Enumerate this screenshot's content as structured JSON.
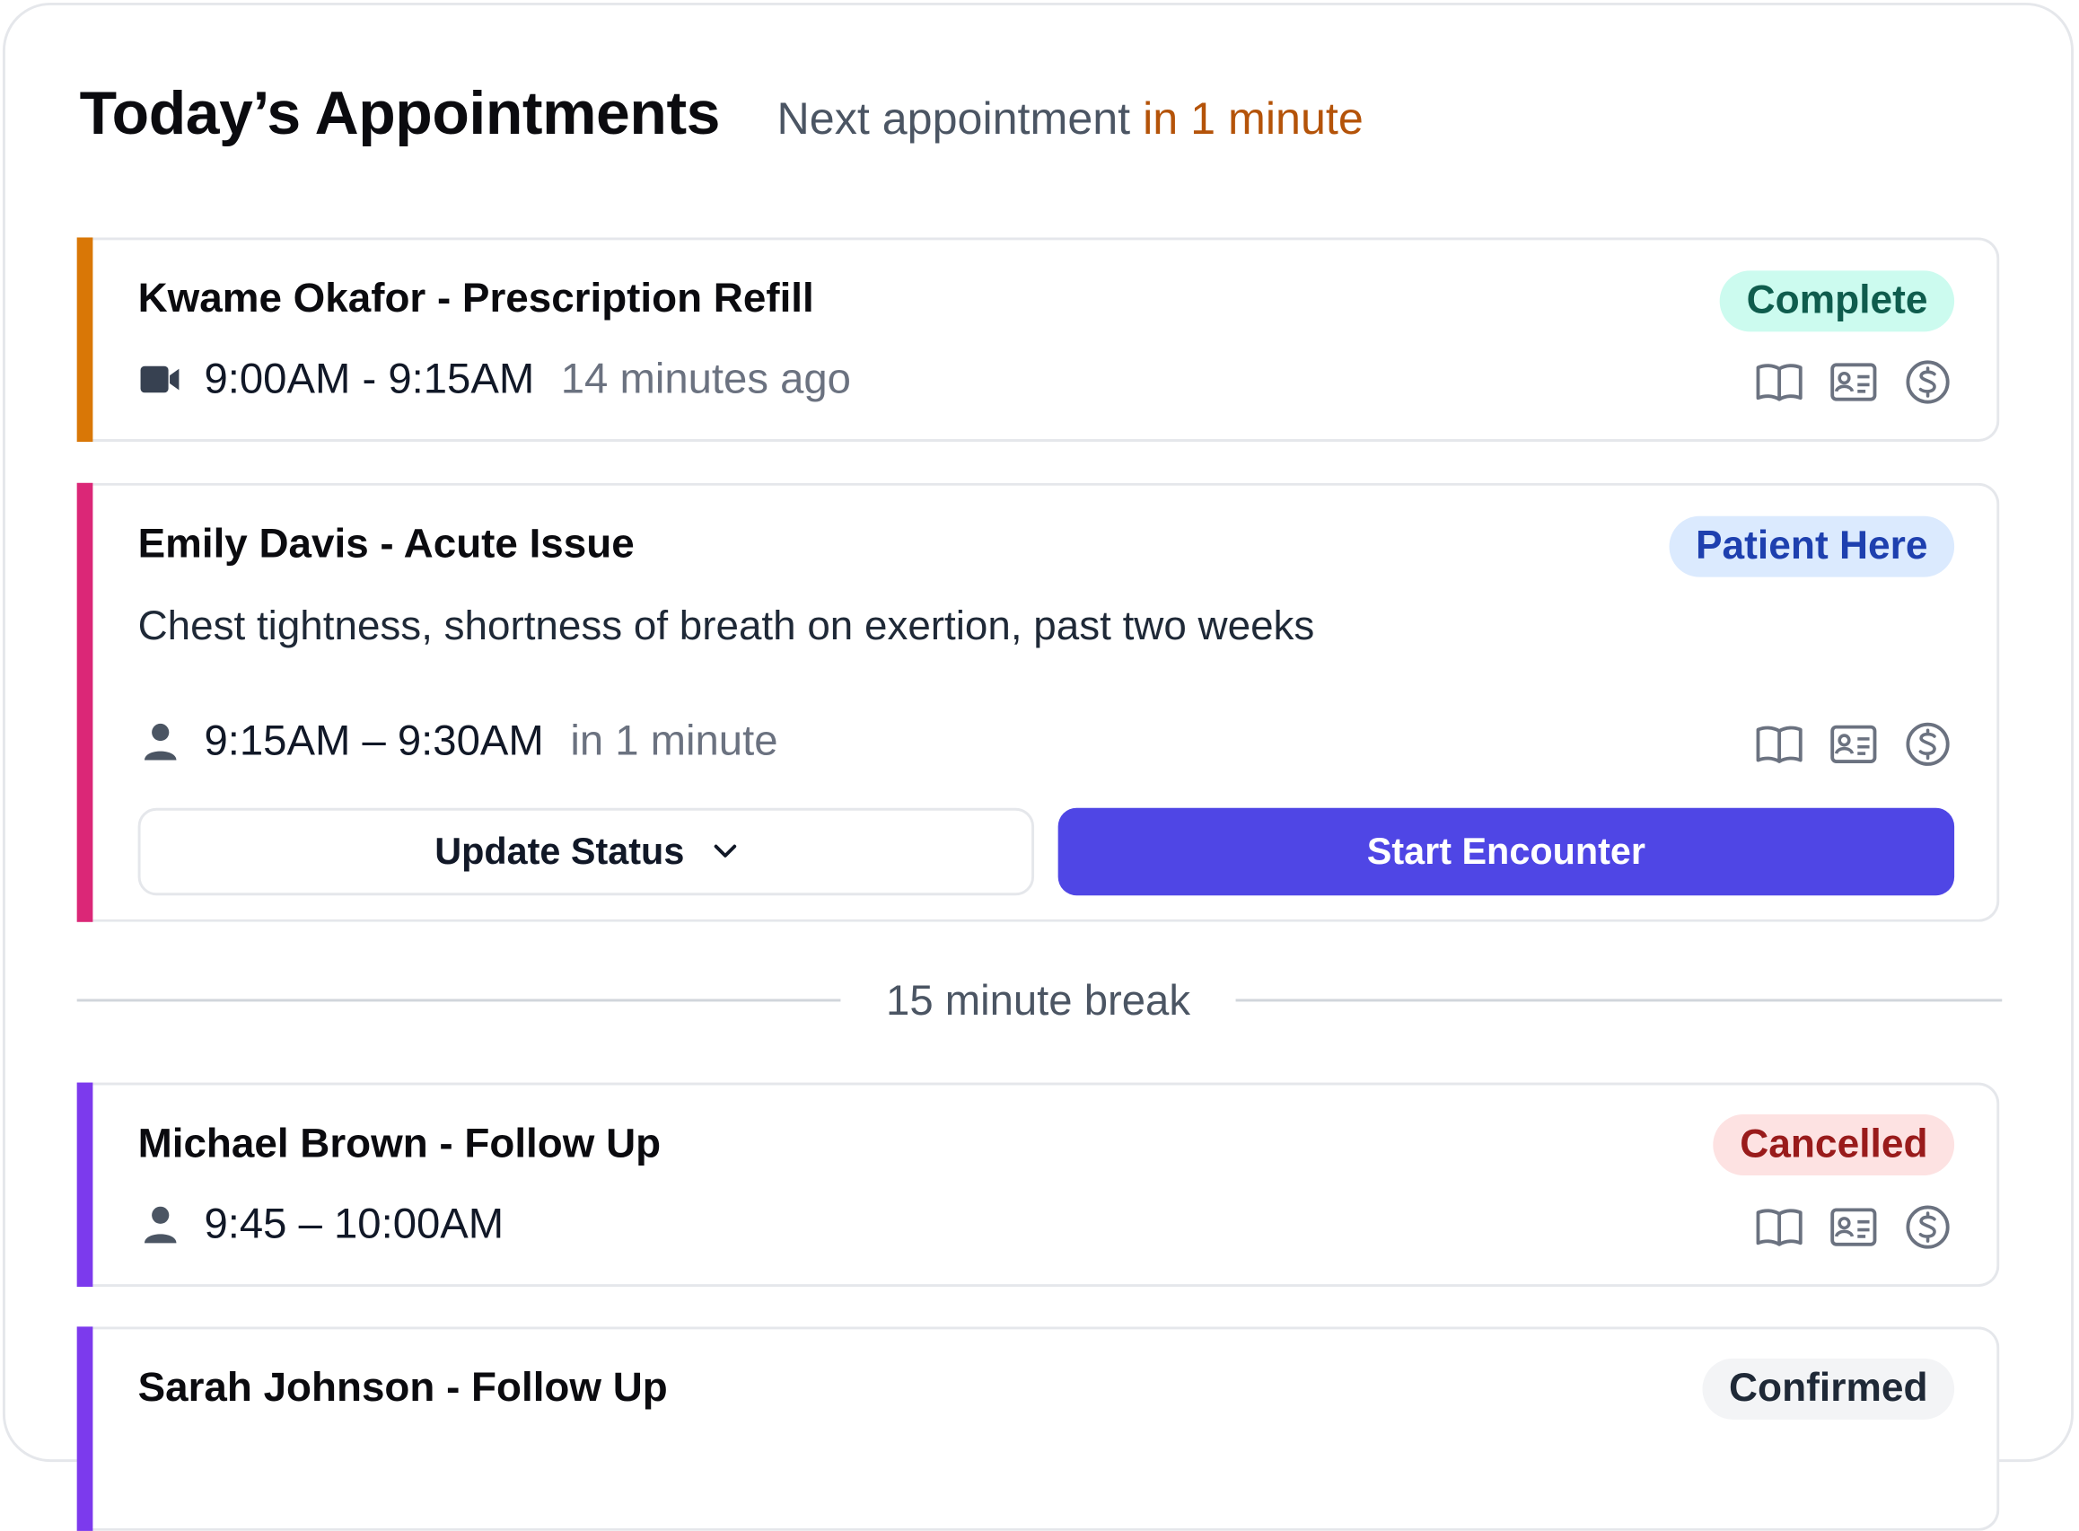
{
  "header": {
    "title": "Today’s Appointments",
    "subtitle_prefix": "Next appointment",
    "subtitle_highlight": "in 1 minute"
  },
  "colors": {
    "accent_orange": "#d97706",
    "accent_pink": "#db2777",
    "accent_purple": "#7c3aed",
    "primary": "#4f46e5",
    "complete_bg": "#ccfbef",
    "complete_fg": "#0f5c4d",
    "patient_here_bg": "#dbeafe",
    "patient_here_fg": "#1e40af",
    "cancelled_bg": "#fde2e2",
    "cancelled_fg": "#991b1b",
    "confirmed_bg": "#f3f4f6",
    "confirmed_fg": "#1f2937"
  },
  "appointments": [
    {
      "title": "Kwame Okafor - Prescription Refill",
      "status": "Complete",
      "type_icon": "video-icon",
      "time": "9:00AM - 9:15AM",
      "relative": "14 minutes ago",
      "icons": [
        "book-icon",
        "id-card-icon",
        "dollar-icon"
      ]
    },
    {
      "title": "Emily Davis - Acute Issue",
      "status": "Patient Here",
      "description": "Chest tightness, shortness of breath on exertion, past two weeks",
      "type_icon": "person-icon",
      "time": "9:15AM – 9:30AM",
      "relative": "in 1 minute",
      "icons": [
        "book-icon",
        "id-card-icon",
        "dollar-icon"
      ],
      "actions": {
        "update_status": "Update Status",
        "start_encounter": "Start Encounter"
      }
    },
    {
      "title": "Michael Brown - Follow Up",
      "status": "Cancelled",
      "type_icon": "person-icon",
      "time": "9:45 – 10:00AM",
      "icons": [
        "book-icon",
        "id-card-icon",
        "dollar-icon"
      ]
    },
    {
      "title": "Sarah Johnson - Follow Up",
      "status": "Confirmed"
    }
  ],
  "break": {
    "label": "15 minute break"
  }
}
